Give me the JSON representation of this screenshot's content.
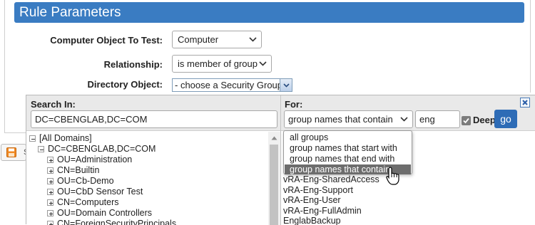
{
  "header": {
    "title": "Rule Parameters"
  },
  "form": {
    "computer_object_label": "Computer Object To Test:",
    "computer_object_value": "Computer",
    "relationship_label": "Relationship:",
    "relationship_value": "is member of group",
    "directory_object_label": "Directory Object:",
    "directory_object_value": "- choose a Security Group -"
  },
  "save_button": {
    "letter": "S"
  },
  "dialog": {
    "search_in_label": "Search In:",
    "search_in_value": "DC=CBENGLAB,DC=COM",
    "for_label": "For:",
    "match_mode_value": "group names that contain",
    "search_text": "eng",
    "deep_label": "Deep",
    "deep_checked": true,
    "go_label": "go",
    "match_mode_options": [
      "all groups",
      "group names that start with",
      "group names that end with",
      "group names that contain"
    ],
    "match_mode_selected_index": 3
  },
  "tree": {
    "root": "[All Domains]",
    "domain": "DC=CBENGLAB,DC=COM",
    "children": [
      "OU=Administration",
      "CN=Builtin",
      "OU=Cb-Demo",
      "OU=CbD Sensor Test",
      "CN=Computers",
      "OU=Domain Controllers",
      "CN=ForeignSecurityPrincipals"
    ]
  },
  "results": [
    "vRA-Eng-SharedAccess",
    "vRA-Eng-Support",
    "vRA-Eng-User",
    "vRA-Eng-FullAdmin",
    "EnglabBackup"
  ],
  "colors": {
    "header_blue": "#3a7cc2",
    "go_blue": "#2e6cb6",
    "selected_option_bg": "#6d6d6d"
  },
  "icons": {
    "save": "floppy-disk-icon",
    "close": "close-icon",
    "expand": "plus-box-icon",
    "collapse": "minus-box-icon",
    "dropdown": "chevron-down-icon",
    "cursor": "mouse-pointer-icon"
  }
}
